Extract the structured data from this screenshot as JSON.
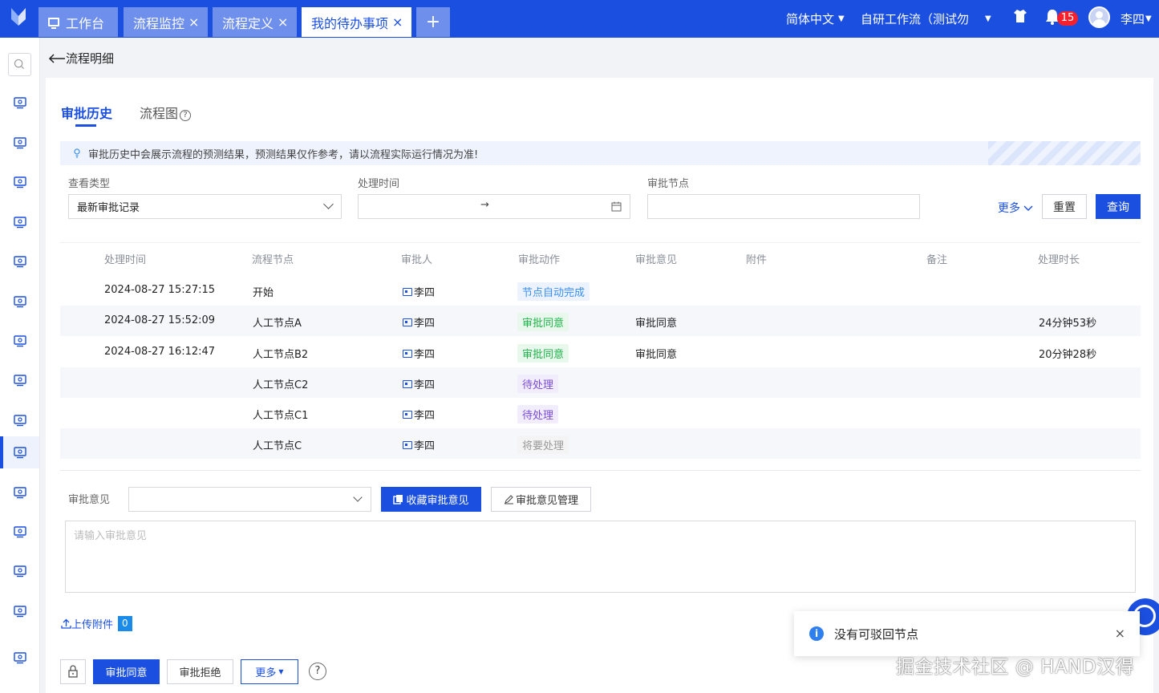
{
  "header": {
    "tabs": [
      {
        "label": "工作台",
        "closable": false
      },
      {
        "label": "流程监控",
        "closable": true
      },
      {
        "label": "流程定义",
        "closable": true
      },
      {
        "label": "我的待办事项",
        "closable": true,
        "active": true
      }
    ],
    "add_tab": "+",
    "close_glyph": "×",
    "language": "简体中文",
    "tenant": "自研工作流（测试勿",
    "notification_count": "15",
    "user": "李四",
    "colors": {
      "brand": "#1a4fe0",
      "tab_inactive": "#6f8fec"
    }
  },
  "sidebar": {
    "icons": [
      "search-icon",
      "monitor-gear-icon",
      "monitor-gear-icon",
      "monitor-gear-icon",
      "org-tree-icon",
      "gear-cluster-icon",
      "code-window-icon",
      "code-window-icon",
      "mail-settings-icon",
      "sliders-icon",
      "flow-list-icon",
      "folder-gear-icon",
      "form-list-icon",
      "chart-window-icon",
      "login-icon",
      "collapse-menu-icon"
    ],
    "active_index": 10
  },
  "page": {
    "back_label": "流程明细",
    "tabs": {
      "history": "审批历史",
      "diagram": "流程图"
    },
    "help_glyph": "?",
    "notice": "审批历史中会展示流程的预测结果，预测结果仅作参考，请以流程实际运行情况为准!"
  },
  "filters": {
    "type_label": "查看类型",
    "type_value": "最新审批记录",
    "time_label": "处理时间",
    "time_sep": "→",
    "node_label": "审批节点",
    "node_value": "",
    "more": "更多",
    "reset": "重置",
    "query": "查询"
  },
  "table": {
    "columns": [
      "处理时间",
      "流程节点",
      "审批人",
      "审批动作",
      "审批意见",
      "附件",
      "备注",
      "处理时长"
    ],
    "rows": [
      {
        "time": "2024-08-27 15:27:15",
        "node": "开始",
        "approver": "李四",
        "action": "节点自动完成",
        "action_kind": "auto",
        "opinion": "",
        "attachment": "",
        "remark": "",
        "duration": ""
      },
      {
        "time": "2024-08-27 15:52:09",
        "node": "人工节点A",
        "approver": "李四",
        "action": "审批同意",
        "action_kind": "ok",
        "opinion": "审批同意",
        "attachment": "",
        "remark": "",
        "duration": "24分钟53秒"
      },
      {
        "time": "2024-08-27 16:12:47",
        "node": "人工节点B2",
        "approver": "李四",
        "action": "审批同意",
        "action_kind": "ok",
        "opinion": "审批同意",
        "attachment": "",
        "remark": "",
        "duration": "20分钟28秒"
      },
      {
        "time": "",
        "node": "人工节点C2",
        "approver": "李四",
        "action": "待处理",
        "action_kind": "pend",
        "opinion": "",
        "attachment": "",
        "remark": "",
        "duration": ""
      },
      {
        "time": "",
        "node": "人工节点C1",
        "approver": "李四",
        "action": "待处理",
        "action_kind": "pend",
        "opinion": "",
        "attachment": "",
        "remark": "",
        "duration": ""
      },
      {
        "time": "",
        "node": "人工节点C",
        "approver": "李四",
        "action": "将要处理",
        "action_kind": "will",
        "opinion": "",
        "attachment": "",
        "remark": "",
        "duration": ""
      }
    ]
  },
  "opinion": {
    "label": "审批意见",
    "select_value": "",
    "save_button": "收藏审批意见",
    "manage_button": "审批意见管理",
    "placeholder": "请输入审批意见"
  },
  "attachments": {
    "upload_label": "上传附件",
    "count": "0"
  },
  "actions": {
    "approve": "审批同意",
    "reject": "审批拒绝",
    "more": "更多"
  },
  "toast": {
    "message": "没有可驳回节点",
    "close": "×"
  },
  "watermark": "掘金技术社区 @ HAND汉得"
}
